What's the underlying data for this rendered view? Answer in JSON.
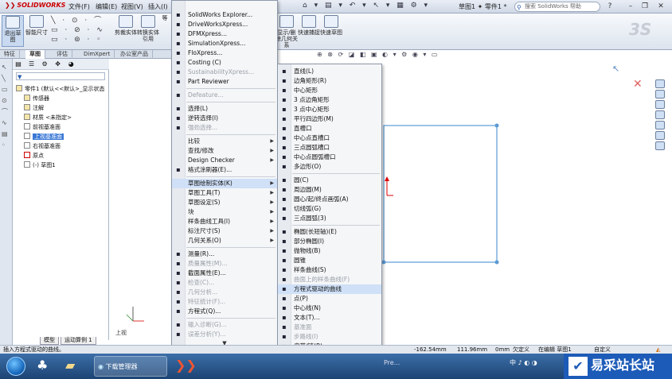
{
  "app": {
    "logo": "SOLIDWORKS",
    "doc_title": "草图1 ✦ 零件1 *",
    "help_search_placeholder": "搜索 SolidWorks 帮助",
    "menu": [
      "文件(F)",
      "编辑(E)",
      "视图(V)",
      "插入(I)"
    ]
  },
  "cmd": {
    "exit_sketch": "退出草图",
    "smart_dim": "智能尺寸",
    "trim": "剪裁实体",
    "convert": "转换实体引用",
    "mirror": "等",
    "display_relations": "显示/删除几何关系",
    "quick_snap": "快速捕捉",
    "rapid_sketch": "快速草图"
  },
  "tabs": [
    "特征",
    "草图",
    "评估",
    "DimXpert",
    "办公室产品"
  ],
  "featuremanager": {
    "tree": [
      {
        "label": "零件1 (默认<<默认>_显示状态"
      },
      {
        "label": "传感器"
      },
      {
        "label": "注解"
      },
      {
        "label": "材质 <未指定>"
      },
      {
        "label": "前视基准面"
      },
      {
        "label": "上视基准面"
      },
      {
        "label": "右视基准面"
      },
      {
        "label": "原点"
      },
      {
        "label": "(-) 草图1"
      }
    ],
    "model_tabs": [
      "模型",
      "运动算例 1"
    ],
    "view_label": "上视"
  },
  "tools_menu": {
    "items": [
      {
        "label": "SolidWorks Explorer...",
        "icon": "explorer-icon",
        "disabled": false
      },
      {
        "label": "DriveWorksXpress...",
        "icon": "driveworks-icon",
        "disabled": false
      },
      {
        "label": "DFMXpress...",
        "icon": "dfm-icon",
        "disabled": false
      },
      {
        "label": "SimulationXpress...",
        "icon": "simulation-icon",
        "disabled": false
      },
      {
        "label": "FloXpress...",
        "icon": "flo-icon",
        "disabled": false
      },
      {
        "label": "Costing (C)",
        "icon": "costing-icon",
        "disabled": false
      },
      {
        "label": "SustainabilityXpress...",
        "icon": "sustainability-icon",
        "disabled": true
      },
      {
        "label": "Part Reviewer",
        "icon": "reviewer-icon",
        "disabled": false
      },
      {
        "sep": true
      },
      {
        "label": "Defeature...",
        "icon": "defeature-icon",
        "disabled": true
      },
      {
        "sep": true
      },
      {
        "label": "选择(L)",
        "icon": "select-icon",
        "disabled": false
      },
      {
        "label": "逆转选择(I)",
        "icon": "invert-icon",
        "disabled": false
      },
      {
        "label": "强劲选择...",
        "icon": "power-select-icon",
        "disabled": true
      },
      {
        "sep": true
      },
      {
        "label": "比较",
        "arrow": true,
        "disabled": false
      },
      {
        "label": "查找/修改",
        "arrow": true,
        "disabled": false
      },
      {
        "label": "Design Checker",
        "arrow": true,
        "disabled": false
      },
      {
        "label": "格式涂刷器(E)...",
        "icon": "brush-icon",
        "disabled": false
      },
      {
        "sep": true
      },
      {
        "label": "草图绘制实体(K)",
        "arrow": true,
        "disabled": false,
        "highlight": true
      },
      {
        "label": "草图工具(T)",
        "arrow": true,
        "disabled": false
      },
      {
        "label": "草图设定(S)",
        "arrow": true,
        "disabled": false
      },
      {
        "label": "块",
        "arrow": true,
        "disabled": false
      },
      {
        "label": "样条曲线工具(I)",
        "arrow": true,
        "disabled": false
      },
      {
        "label": "标注尺寸(S)",
        "arrow": true,
        "disabled": false
      },
      {
        "label": "几何关系(O)",
        "arrow": true,
        "disabled": false
      },
      {
        "sep": true
      },
      {
        "label": "测量(R)...",
        "icon": "measure-icon",
        "disabled": false
      },
      {
        "label": "质量属性(M)...",
        "icon": "mass-icon",
        "disabled": true
      },
      {
        "label": "截面属性(E)...",
        "icon": "section-icon",
        "disabled": false
      },
      {
        "label": "检查(C)...",
        "icon": "check-icon",
        "disabled": true
      },
      {
        "label": "几何分析...",
        "icon": "geom-icon",
        "disabled": true
      },
      {
        "label": "特征统计(F)...",
        "icon": "stats-icon",
        "disabled": true
      },
      {
        "label": "方程式(Q)...",
        "icon": "sigma-icon",
        "disabled": false
      },
      {
        "sep": true
      },
      {
        "label": "输入诊断(G)...",
        "icon": "import-icon",
        "disabled": true
      },
      {
        "label": "误差分析(Y)...",
        "icon": "error-icon",
        "disabled": true
      }
    ]
  },
  "entities_menu": {
    "items": [
      {
        "label": "直线(L)",
        "icon": "line-icon"
      },
      {
        "label": "边角矩形(R)",
        "icon": "rectangle-icon"
      },
      {
        "label": "中心矩形",
        "icon": "center-rect-icon"
      },
      {
        "label": "3 点边角矩形",
        "icon": "3pt-rect-icon"
      },
      {
        "label": "3 点中心矩形",
        "icon": "3pt-center-rect-icon"
      },
      {
        "label": "平行四边形(M)",
        "icon": "parallelogram-icon"
      },
      {
        "label": "直槽口",
        "icon": "slot-icon"
      },
      {
        "label": "中心点直槽口",
        "icon": "center-slot-icon"
      },
      {
        "label": "三点圆弧槽口",
        "icon": "arc-slot-icon"
      },
      {
        "label": "中心点圆弧槽口",
        "icon": "center-arc-slot-icon"
      },
      {
        "label": "多边形(O)",
        "icon": "polygon-icon"
      },
      {
        "sep": true
      },
      {
        "label": "圆(C)",
        "icon": "circle-icon"
      },
      {
        "label": "周边圆(M)",
        "icon": "perimeter-circle-icon"
      },
      {
        "label": "圆心/起/终点画弧(A)",
        "icon": "center-arc-icon"
      },
      {
        "label": "切线弧(G)",
        "icon": "tangent-arc-icon"
      },
      {
        "label": "三点圆弧(3)",
        "icon": "3pt-arc-icon"
      },
      {
        "sep": true
      },
      {
        "label": "椭圆(长短轴)(E)",
        "icon": "ellipse-icon"
      },
      {
        "label": "部分椭圆(I)",
        "icon": "partial-ellipse-icon"
      },
      {
        "label": "抛物线(B)",
        "icon": "parabola-icon"
      },
      {
        "label": "圆锥",
        "icon": "conic-icon"
      },
      {
        "label": "样条曲线(S)",
        "icon": "spline-icon"
      },
      {
        "label": "曲面上的样条曲线(F)",
        "icon": "surface-spline-icon",
        "disabled": true
      },
      {
        "label": "方程式驱动的曲线",
        "icon": "equation-curve-icon",
        "highlight": true
      },
      {
        "label": "点(P)",
        "icon": "point-icon"
      },
      {
        "label": "中心线(N)",
        "icon": "centerline-icon"
      },
      {
        "label": "文本(T)...",
        "icon": "text-icon"
      },
      {
        "label": "基准面",
        "icon": "plane-icon",
        "disabled": true
      },
      {
        "label": "步路线(I)",
        "icon": "route-icon",
        "disabled": true
      },
      {
        "label": "皮带/链(B)",
        "icon": "belt-icon"
      },
      {
        "sep": true
      },
      {
        "label": "自定义菜单(M)",
        "icon": ""
      }
    ]
  },
  "status": {
    "hint": "插入方程式驱动的曲线。",
    "x": "-162.54mm",
    "y": "111.96mm",
    "z": "0mm",
    "state": "欠定义",
    "editing": "在编辑 草图1",
    "custom": "自定义"
  },
  "taskbar": {
    "browser_task": "下载管理器",
    "tray_text": "中 ♪ ◐ ◑"
  },
  "watermark": {
    "text": "易采站长站"
  },
  "colors": {
    "sketch_line": "#5b9bd5",
    "highlight": "#cfe0f7",
    "selection": "#3a78d6"
  }
}
